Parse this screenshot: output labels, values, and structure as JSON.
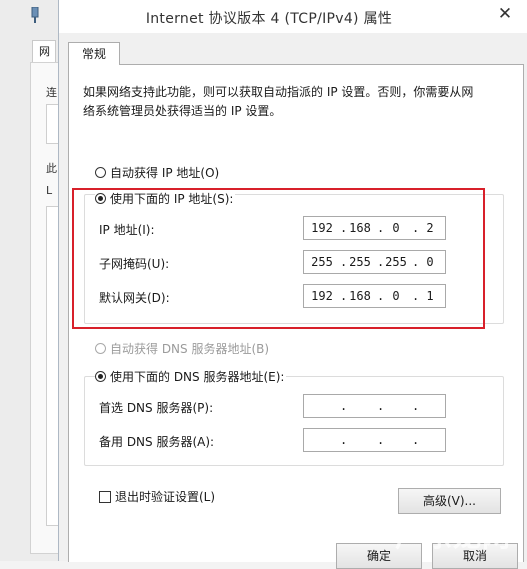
{
  "background_window": {
    "tab_label": "网",
    "labels": [
      "连",
      "此",
      "L"
    ]
  },
  "dialog": {
    "title": "Internet 协议版本 4 (TCP/IPv4) 属性",
    "close_glyph": "✕",
    "tab_label": "常规",
    "description_line1": "如果网络支持此功能，则可以获取自动指派的 IP 设置。否则，你需要从网",
    "description_line2": "络系统管理员处获得适当的 IP 设置。",
    "ip_mode": {
      "auto_label": "自动获得 IP 地址(O)",
      "manual_label": "使用下面的 IP 地址(S):",
      "selected": "manual"
    },
    "ip_fields": [
      {
        "label": "IP 地址(I):",
        "segments": [
          "192",
          "168",
          "0",
          "2"
        ]
      },
      {
        "label": "子网掩码(U):",
        "segments": [
          "255",
          "255",
          "255",
          "0"
        ]
      },
      {
        "label": "默认网关(D):",
        "segments": [
          "192",
          "168",
          "0",
          "1"
        ]
      }
    ],
    "dns_mode": {
      "auto_label": "自动获得 DNS 服务器地址(B)",
      "manual_label": "使用下面的 DNS 服务器地址(E):",
      "selected": "manual",
      "auto_disabled": true
    },
    "dns_fields": [
      {
        "label": "首选 DNS 服务器(P):",
        "segments": [
          "",
          "",
          "",
          ""
        ]
      },
      {
        "label": "备用 DNS 服务器(A):",
        "segments": [
          "",
          "",
          "",
          ""
        ]
      }
    ],
    "validate_on_exit_label": "退出时验证设置(L)",
    "validate_on_exit_checked": false,
    "advanced_button": "高级(V)...",
    "ok_button": "确定",
    "cancel_button": "取消",
    "highlight_color": "#d8202a"
  },
  "watermark": "广东龙网"
}
